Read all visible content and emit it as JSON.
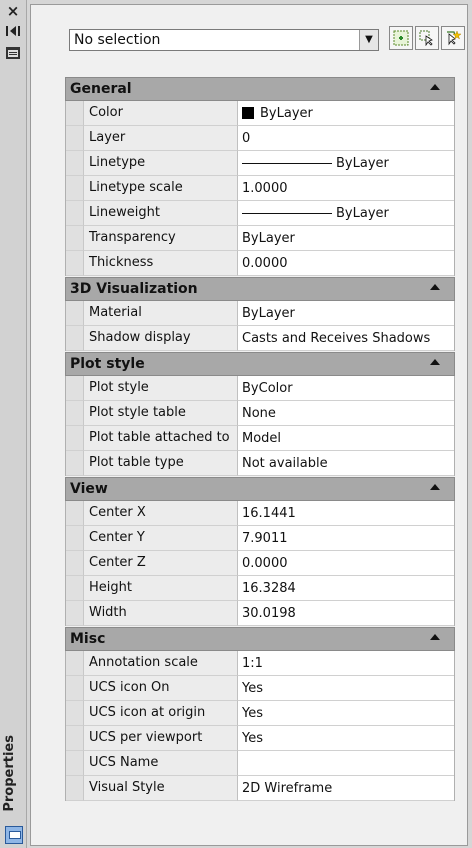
{
  "side": {
    "close_icon": "×",
    "title": "Properties"
  },
  "toolbar": {
    "selection": "No selection"
  },
  "sections": [
    {
      "title": "General",
      "rows": [
        {
          "name": "Color",
          "value": "ByLayer",
          "kind": "swatch"
        },
        {
          "name": "Layer",
          "value": "0"
        },
        {
          "name": "Linetype",
          "value": "ByLayer",
          "kind": "line"
        },
        {
          "name": "Linetype scale",
          "value": "1.0000"
        },
        {
          "name": "Lineweight",
          "value": "ByLayer",
          "kind": "line"
        },
        {
          "name": "Transparency",
          "value": "ByLayer"
        },
        {
          "name": "Thickness",
          "value": "0.0000"
        }
      ]
    },
    {
      "title": "3D Visualization",
      "rows": [
        {
          "name": "Material",
          "value": "ByLayer"
        },
        {
          "name": "Shadow display",
          "value": "Casts and Receives Shadows"
        }
      ]
    },
    {
      "title": "Plot style",
      "rows": [
        {
          "name": "Plot style",
          "value": "ByColor"
        },
        {
          "name": "Plot style table",
          "value": "None"
        },
        {
          "name": "Plot table attached to",
          "value": "Model"
        },
        {
          "name": "Plot table type",
          "value": "Not available"
        }
      ]
    },
    {
      "title": "View",
      "rows": [
        {
          "name": "Center X",
          "value": "16.1441"
        },
        {
          "name": "Center Y",
          "value": "7.9011"
        },
        {
          "name": "Center Z",
          "value": "0.0000"
        },
        {
          "name": "Height",
          "value": "16.3284"
        },
        {
          "name": "Width",
          "value": "30.0198"
        }
      ]
    },
    {
      "title": "Misc",
      "rows": [
        {
          "name": "Annotation scale",
          "value": "1:1"
        },
        {
          "name": "UCS icon On",
          "value": "Yes"
        },
        {
          "name": "UCS icon at origin",
          "value": "Yes"
        },
        {
          "name": "UCS per viewport",
          "value": "Yes"
        },
        {
          "name": "UCS Name",
          "value": ""
        },
        {
          "name": "Visual Style",
          "value": "2D Wireframe"
        }
      ]
    }
  ]
}
